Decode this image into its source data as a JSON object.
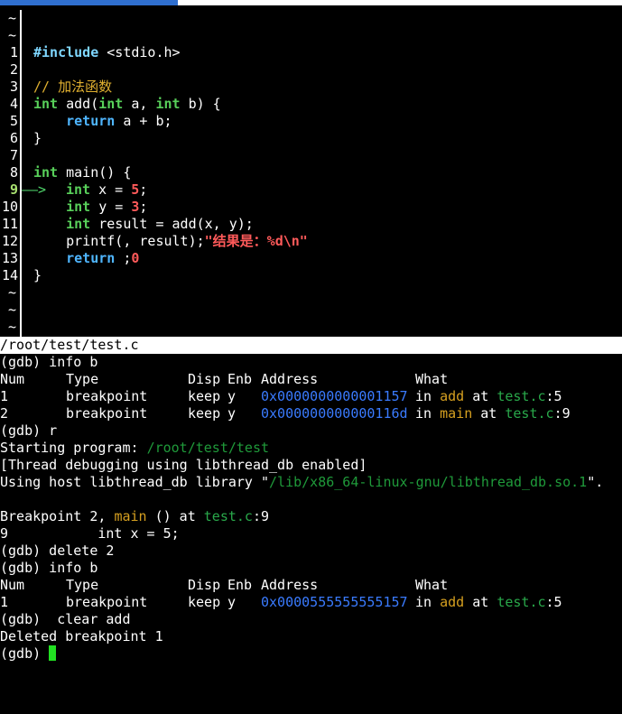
{
  "editor": {
    "lines": [
      {
        "num": "~",
        "code": ""
      },
      {
        "num": "~",
        "code": ""
      },
      {
        "num": "1",
        "pre": "#include",
        "rest": " <stdio.h>"
      },
      {
        "num": "2",
        "code": ""
      },
      {
        "num": "3",
        "comment": "// 加法函数"
      },
      {
        "num": "4",
        "k1": "int",
        "t1": " add(",
        "k2": "int",
        "t2": " a, ",
        "k3": "int",
        "t3": " b) {"
      },
      {
        "num": "5",
        "ind": "    ",
        "ret": "return",
        "rest": " a + b;"
      },
      {
        "num": "6",
        "code": "}"
      },
      {
        "num": "7",
        "code": ""
      },
      {
        "num": "8",
        "k1": "int",
        "t1": " main() {"
      },
      {
        "num": "9",
        "arrow": "——> ",
        "k1": "int",
        "t1": " x = ",
        "n": "5",
        "t2": ";"
      },
      {
        "num": "10",
        "ind": "    ",
        "k1": "int",
        "t1": " y = ",
        "n": "3",
        "t2": ";"
      },
      {
        "num": "11",
        "ind": "    ",
        "k1": "int",
        "t1": " result = add(x, y);"
      },
      {
        "num": "12",
        "ind": "    ",
        "t0": "printf(",
        "s": "\"结果是：%d\\n\"",
        "t1": ", result);"
      },
      {
        "num": "13",
        "ind": "    ",
        "ret": "return",
        "t0": " ",
        "n": "0",
        "t1": ";"
      },
      {
        "num": "14",
        "code": "}"
      },
      {
        "num": "~",
        "code": ""
      },
      {
        "num": "~",
        "code": ""
      },
      {
        "num": "~",
        "code": ""
      }
    ],
    "status_path": "/root/test/test.c"
  },
  "gdb": {
    "cmd1": "(gdb) info b",
    "hdr": {
      "num": "Num",
      "type": "Type",
      "disp": "Disp",
      "enb": "Enb",
      "address": "Address",
      "what": "What"
    },
    "bp_rows": [
      {
        "num": "1",
        "type": "breakpoint",
        "disp": "keep",
        "enb": "y",
        "address": "0x0000000000001157",
        "in": " in ",
        "fn": "add",
        "at": " at ",
        "file": "test.c",
        "line": ":5"
      },
      {
        "num": "2",
        "type": "breakpoint",
        "disp": "keep",
        "enb": "y",
        "address": "0x000000000000116d",
        "in": " in ",
        "fn": "main",
        "at": " at ",
        "file": "test.c",
        "line": ":9"
      }
    ],
    "cmd2": "(gdb) r",
    "starting": "Starting program: ",
    "prog_path": "/root/test/test",
    "thread_msg": "[Thread debugging using libthread_db enabled]",
    "host_msg": "Using host libthread_db library \"",
    "host_path": "/lib/x86_64-linux-gnu/libthread_db.so.1",
    "host_end": "\".",
    "bp_hit": "Breakpoint 2, ",
    "bp_fn": "main",
    "bp_mid": " () at ",
    "bp_file": "test.c",
    "bp_line": ":9",
    "src_line_num": "9",
    "src_line_code": "           int x = 5;",
    "cmd3": "(gdb) delete 2",
    "cmd4": "(gdb) info b",
    "bp_rows2": [
      {
        "num": "1",
        "type": "breakpoint",
        "disp": "keep",
        "enb": "y",
        "address": "0x0000555555555157",
        "in": " in ",
        "fn": "add",
        "at": " at ",
        "file": "test.c",
        "line": ":5"
      }
    ],
    "cmd5": "(gdb)  clear add",
    "deleted": "Deleted breakpoint 1",
    "prompt": "(gdb) "
  }
}
